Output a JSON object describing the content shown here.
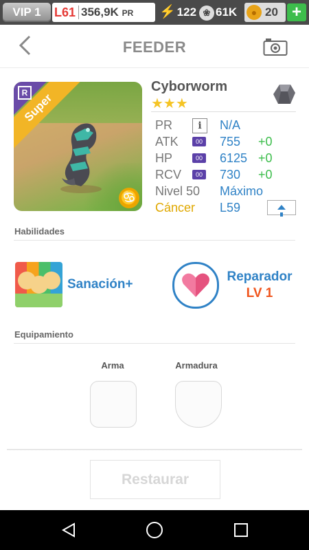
{
  "status": {
    "vip": "VIP 1",
    "level": "L61",
    "pr": "356,9K",
    "pr_unit": "PR",
    "energy": "122",
    "paws": "61K",
    "coins": "20",
    "plus": "+"
  },
  "header": {
    "title": "FEEDER"
  },
  "monster": {
    "name": "Cyborworm",
    "stars": "★★★",
    "star_count": 3,
    "ribbon": "Super",
    "rank": "R",
    "zodiac_symbol": "♋",
    "stats": {
      "pr_label": "PR",
      "pr_icon": "i",
      "pr_value": "N/A",
      "atk_label": "ATK",
      "atk_badge": "00",
      "atk_value": "755",
      "atk_bonus": "+0",
      "hp_label": "HP",
      "hp_badge": "00",
      "hp_value": "6125",
      "hp_bonus": "+0",
      "rcv_label": "RCV",
      "rcv_badge": "00",
      "rcv_value": "730",
      "rcv_bonus": "+0",
      "level_label": "Nivel 50",
      "level_value": "Máximo",
      "sign_label": "Cáncer",
      "sign_value": "L59"
    }
  },
  "skills": {
    "title": "Habilidades",
    "skill1_name": "Sanación+",
    "skill2_name": "Reparador",
    "skill2_level": "LV 1"
  },
  "equipment": {
    "title": "Equipamiento",
    "weapon_label": "Arma",
    "armor_label": "Armadura"
  },
  "actions": {
    "restore": "Restaurar"
  },
  "colors": {
    "accent_blue": "#2f82c6",
    "bonus_green": "#3dbd4c",
    "level_red": "#e53935",
    "sign_gold": "#e0a800"
  }
}
